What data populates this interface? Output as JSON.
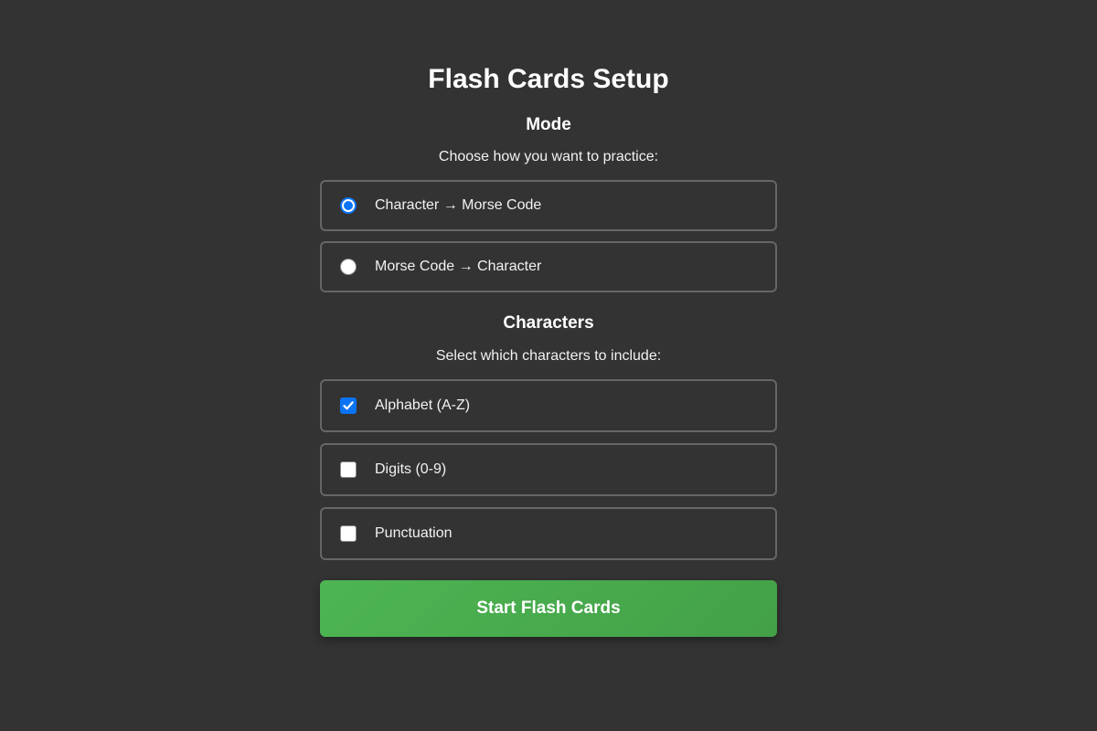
{
  "title": "Flash Cards Setup",
  "mode": {
    "heading": "Mode",
    "description": "Choose how you want to practice:",
    "options": [
      {
        "label": "Character → Morse Code",
        "selected": true
      },
      {
        "label": "Morse Code → Character",
        "selected": false
      }
    ]
  },
  "characters": {
    "heading": "Characters",
    "description": "Select which characters to include:",
    "options": [
      {
        "label": "Alphabet (A-Z)",
        "checked": true
      },
      {
        "label": "Digits (0-9)",
        "checked": false
      },
      {
        "label": "Punctuation",
        "checked": false
      }
    ]
  },
  "start_button": {
    "label": "Start Flash Cards"
  },
  "colors": {
    "background": "#333333",
    "accent_blue": "#0b74f5",
    "button_green": "#4caf50",
    "option_border": "#666666"
  }
}
